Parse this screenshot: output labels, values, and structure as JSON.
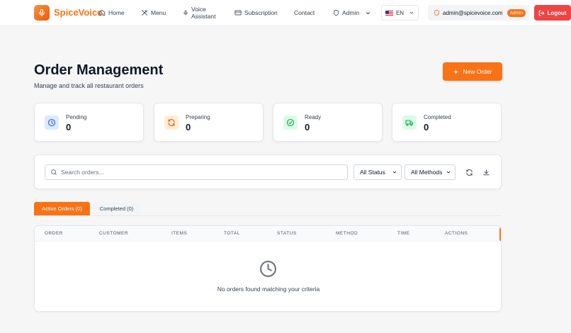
{
  "nav": {
    "brand": "SpiceVoice",
    "links": [
      {
        "label": "Home",
        "icon": "home-icon"
      },
      {
        "label": "Menu",
        "icon": "utensils-icon"
      },
      {
        "label": "Voice Assistant",
        "icon": "mic-icon"
      },
      {
        "label": "Subscription",
        "icon": "credit-card-icon"
      },
      {
        "label": "Contact",
        "icon": ""
      },
      {
        "label": "Admin",
        "icon": "shield-icon"
      }
    ],
    "language": "EN",
    "user_email": "admin@spicevoice.com",
    "user_role": "Admin",
    "logout_label": "Logout"
  },
  "page": {
    "title": "Order Management",
    "subtitle": "Manage and track all restaurant orders",
    "new_order_label": "New Order"
  },
  "stats": [
    {
      "label": "Pending",
      "value": "0",
      "icon": "clock-icon",
      "bg": "#dbeafe",
      "fg": "#2563eb"
    },
    {
      "label": "Preparing",
      "value": "0",
      "icon": "refresh-icon",
      "bg": "#ffedd5",
      "fg": "#ea580c"
    },
    {
      "label": "Ready",
      "value": "0",
      "icon": "check-circle-icon",
      "bg": "#dcfce7",
      "fg": "#16a34a"
    },
    {
      "label": "Completed",
      "value": "0",
      "icon": "truck-icon",
      "bg": "#dcfce7",
      "fg": "#16a34a"
    }
  ],
  "filters": {
    "search_placeholder": "Search orders...",
    "status_selected": "All Status",
    "method_selected": "All Methods"
  },
  "tabs": [
    {
      "label": "Active Orders (0)",
      "active": true
    },
    {
      "label": "Completed (0)",
      "active": false
    }
  ],
  "table": {
    "columns": [
      "ORDER",
      "CUSTOMER",
      "ITEMS",
      "TOTAL",
      "STATUS",
      "METHOD",
      "TIME",
      "ACTIONS"
    ],
    "empty_message": "No orders found matching your criteria"
  },
  "colors": {
    "accent": "#f97316",
    "danger": "#ef4444"
  }
}
